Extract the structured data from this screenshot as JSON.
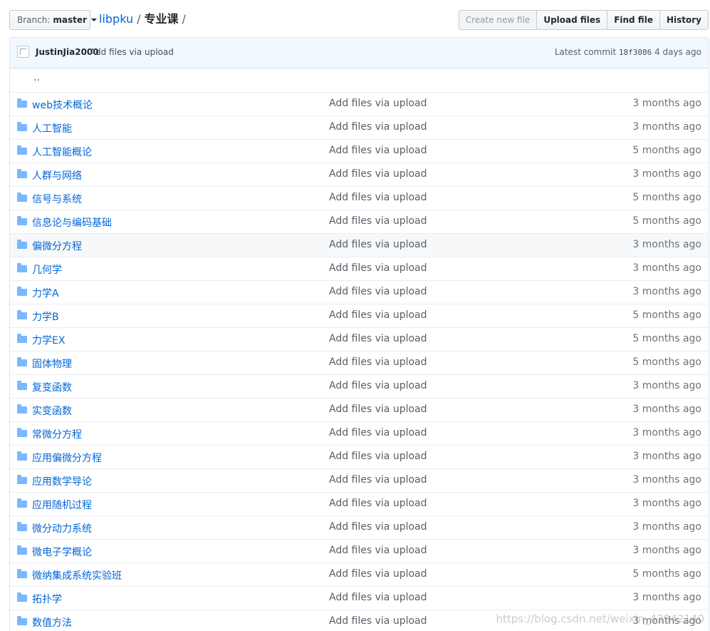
{
  "toolbar": {
    "branch_label": "Branch:",
    "branch_value": "master",
    "repo": "libpku",
    "sep1": "/",
    "folder": "专业课",
    "sep2": "/",
    "create_new_file": "Create new file",
    "upload_files": "Upload files",
    "find_file": "Find file",
    "history": "History"
  },
  "commit": {
    "author": "JustinJia2000",
    "message": "Add files via upload",
    "latest_label": "Latest commit",
    "sha": "18f3086",
    "age": "4 days ago"
  },
  "parent_link": "..",
  "files": [
    {
      "name": "web技术概论",
      "message": "Add files via upload",
      "age": "3 months ago"
    },
    {
      "name": "人工智能",
      "message": "Add files via upload",
      "age": "3 months ago"
    },
    {
      "name": "人工智能概论",
      "message": "Add files via upload",
      "age": "5 months ago"
    },
    {
      "name": "人群与网络",
      "message": "Add files via upload",
      "age": "3 months ago"
    },
    {
      "name": "信号与系统",
      "message": "Add files via upload",
      "age": "5 months ago"
    },
    {
      "name": "信息论与编码基础",
      "message": "Add files via upload",
      "age": "5 months ago"
    },
    {
      "name": "偏微分方程",
      "message": "Add files via upload",
      "age": "3 months ago"
    },
    {
      "name": "几何学",
      "message": "Add files via upload",
      "age": "3 months ago"
    },
    {
      "name": "力学A",
      "message": "Add files via upload",
      "age": "3 months ago"
    },
    {
      "name": "力学B",
      "message": "Add files via upload",
      "age": "5 months ago"
    },
    {
      "name": "力学EX",
      "message": "Add files via upload",
      "age": "5 months ago"
    },
    {
      "name": "固体物理",
      "message": "Add files via upload",
      "age": "5 months ago"
    },
    {
      "name": "复变函数",
      "message": "Add files via upload",
      "age": "3 months ago"
    },
    {
      "name": "实变函数",
      "message": "Add files via upload",
      "age": "3 months ago"
    },
    {
      "name": "常微分方程",
      "message": "Add files via upload",
      "age": "3 months ago"
    },
    {
      "name": "应用偏微分方程",
      "message": "Add files via upload",
      "age": "3 months ago"
    },
    {
      "name": "应用数学导论",
      "message": "Add files via upload",
      "age": "3 months ago"
    },
    {
      "name": "应用随机过程",
      "message": "Add files via upload",
      "age": "3 months ago"
    },
    {
      "name": "微分动力系统",
      "message": "Add files via upload",
      "age": "3 months ago"
    },
    {
      "name": "微电子学概论",
      "message": "Add files via upload",
      "age": "3 months ago"
    },
    {
      "name": "微纳集成系统实验班",
      "message": "Add files via upload",
      "age": "5 months ago"
    },
    {
      "name": "拓扑学",
      "message": "Add files via upload",
      "age": "3 months ago"
    },
    {
      "name": "数值方法",
      "message": "Add files via upload",
      "age": "3 months ago"
    }
  ],
  "watermark": "https://blog.csdn.net/weixin_43942140",
  "colors": {
    "link": "#0366d6",
    "folder_icon": "#79b8ff",
    "commit_bar_bg": "#f1f8ff"
  }
}
